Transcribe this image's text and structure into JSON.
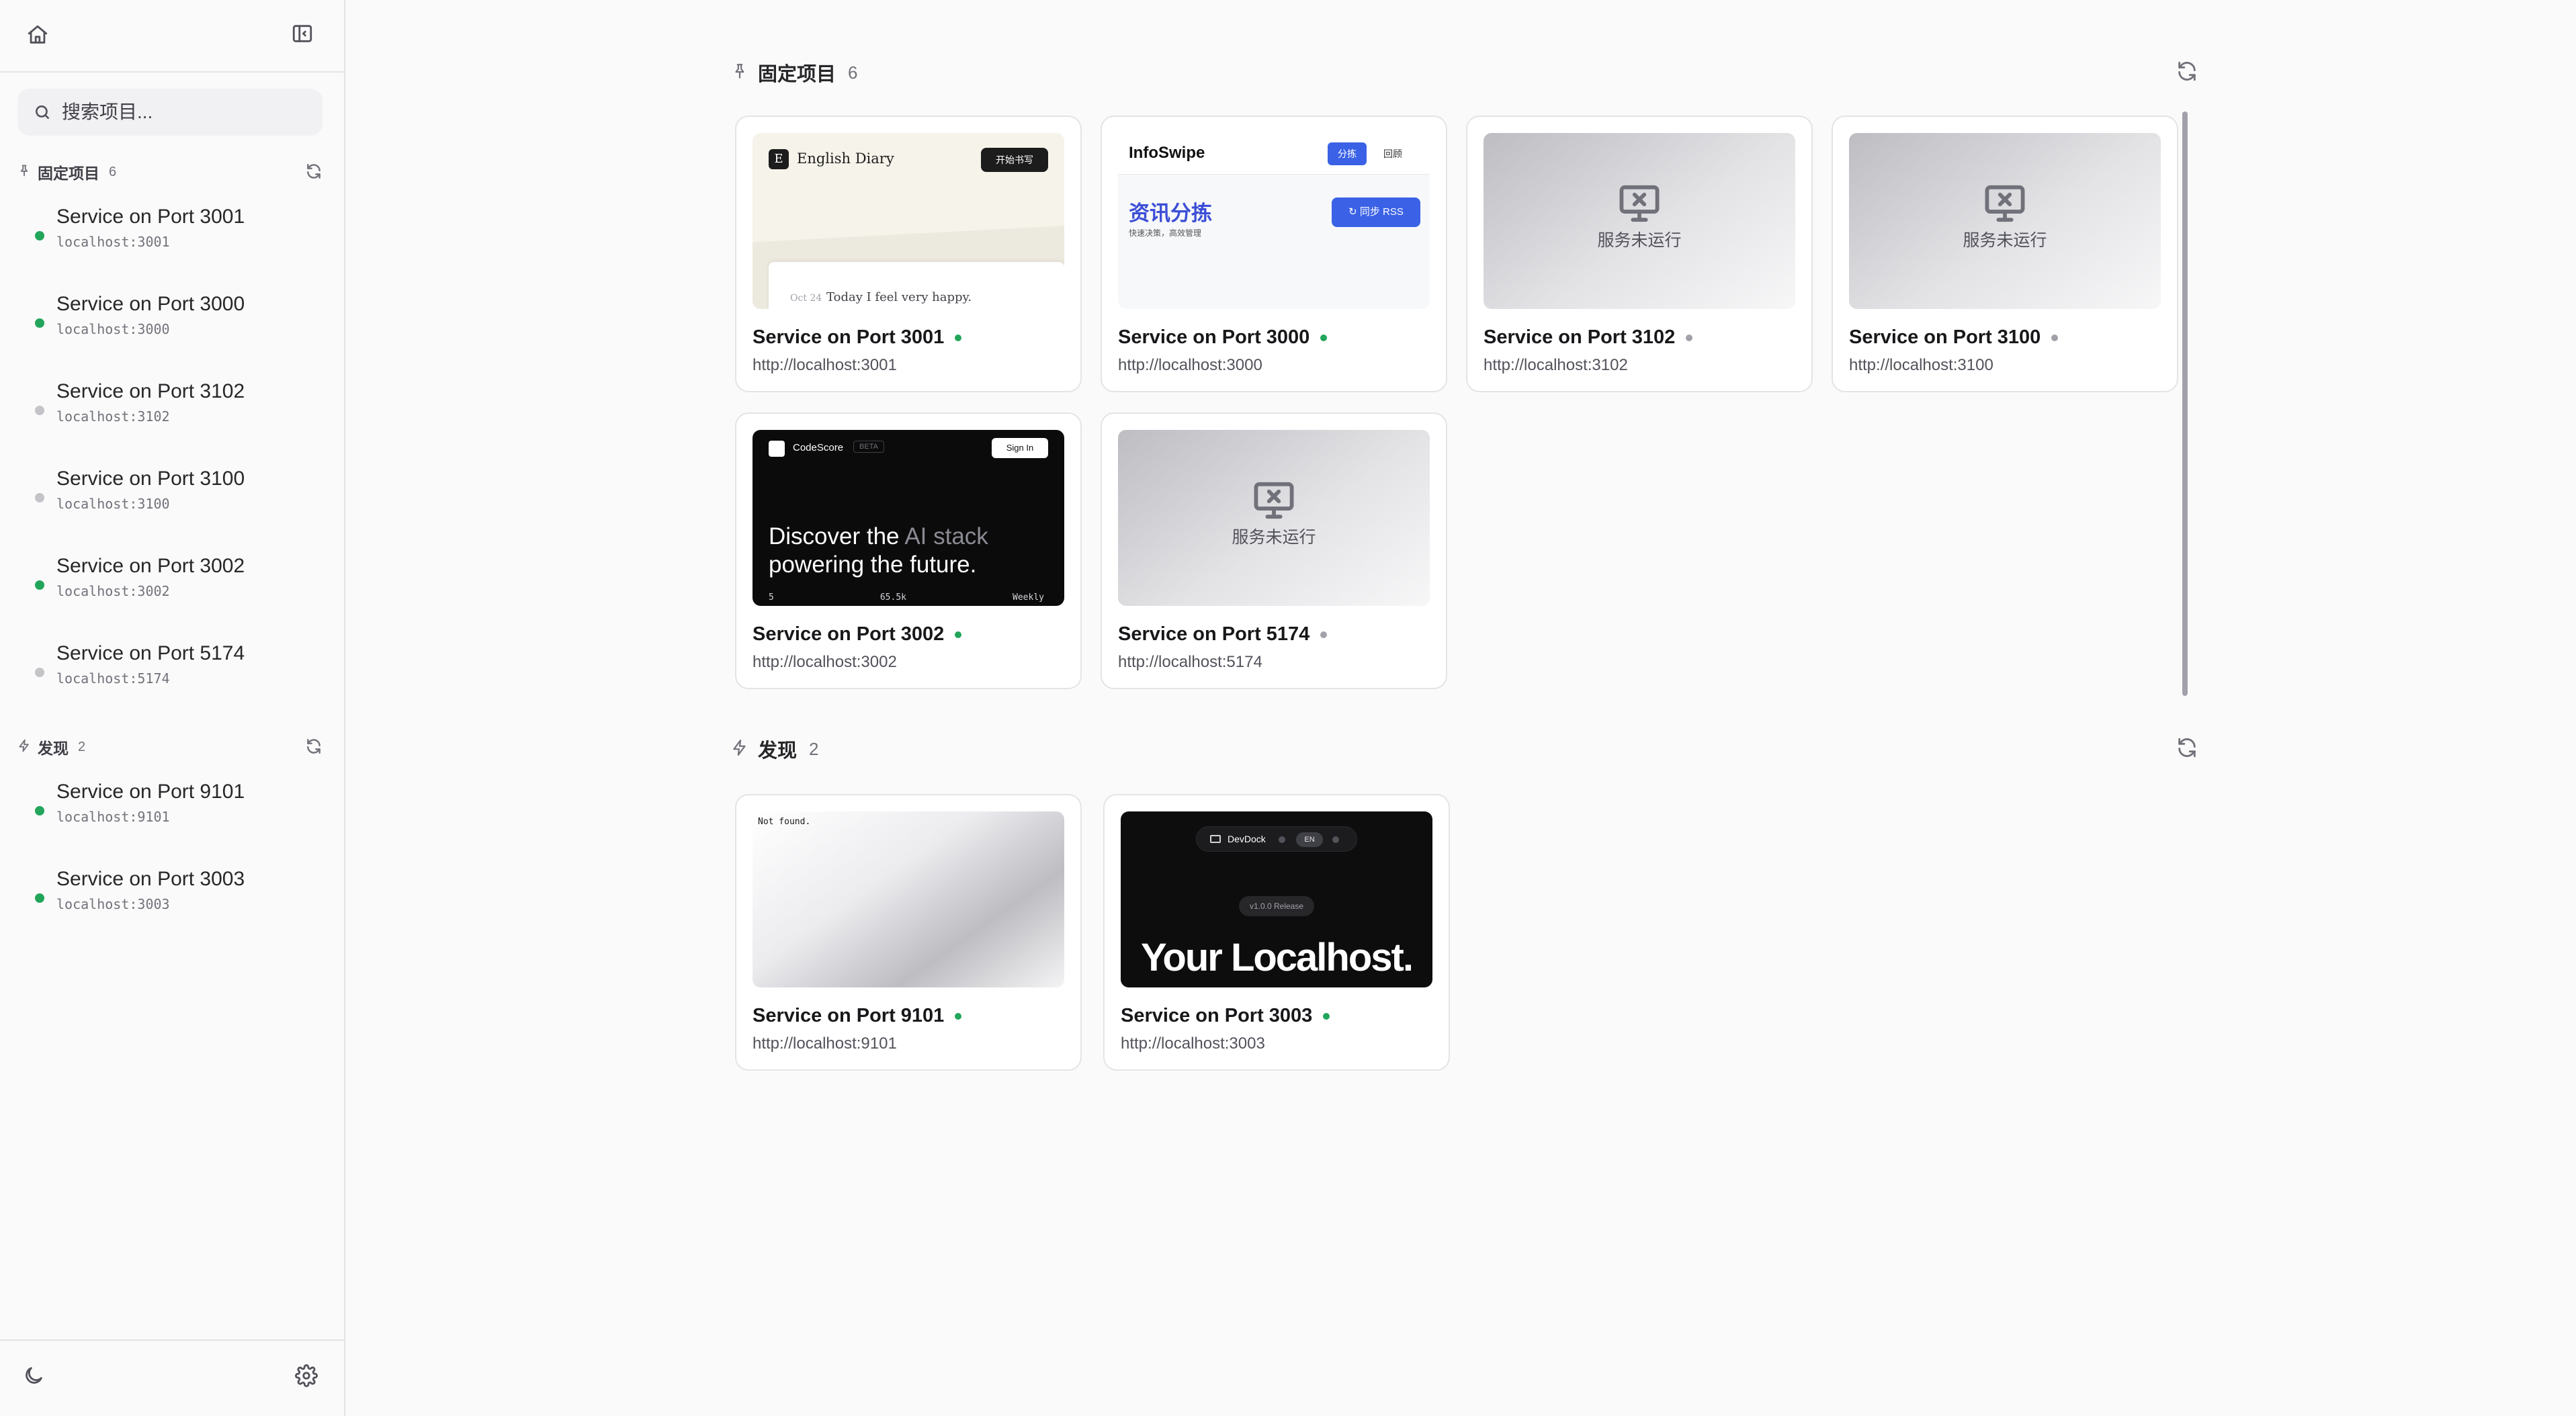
{
  "sidebar": {
    "search_placeholder": "搜索项目...",
    "pinned": {
      "title": "固定项目",
      "count": "6",
      "items": [
        {
          "name": "Service on Port 3001",
          "host": "localhost:3001",
          "status": "running"
        },
        {
          "name": "Service on Port 3000",
          "host": "localhost:3000",
          "status": "running"
        },
        {
          "name": "Service on Port 3102",
          "host": "localhost:3102",
          "status": "stopped"
        },
        {
          "name": "Service on Port 3100",
          "host": "localhost:3100",
          "status": "stopped"
        },
        {
          "name": "Service on Port 3002",
          "host": "localhost:3002",
          "status": "running"
        },
        {
          "name": "Service on Port 5174",
          "host": "localhost:5174",
          "status": "stopped"
        }
      ]
    },
    "discovered": {
      "title": "发现",
      "count": "2",
      "items": [
        {
          "name": "Service on Port 9101",
          "host": "localhost:9101",
          "status": "running"
        },
        {
          "name": "Service on Port 3003",
          "host": "localhost:3003",
          "status": "running"
        }
      ]
    },
    "icons": {
      "home": "home-icon",
      "collapse": "sidebar-collapse-icon",
      "theme": "moon-icon",
      "settings": "gear-icon"
    }
  },
  "main": {
    "pinned": {
      "title": "固定项目",
      "count": "6",
      "cards": [
        {
          "title": "Service on Port 3001",
          "url": "http://localhost:3001",
          "status": "running",
          "preview": "diary"
        },
        {
          "title": "Service on Port 3000",
          "url": "http://localhost:3000",
          "status": "running",
          "preview": "infoswipe"
        },
        {
          "title": "Service on Port 3102",
          "url": "http://localhost:3102",
          "status": "stopped",
          "preview": "offline"
        },
        {
          "title": "Service on Port 3100",
          "url": "http://localhost:3100",
          "status": "stopped",
          "preview": "offline"
        },
        {
          "title": "Service on Port 3002",
          "url": "http://localhost:3002",
          "status": "running",
          "preview": "codescore"
        },
        {
          "title": "Service on Port 5174",
          "url": "http://localhost:5174",
          "status": "stopped",
          "preview": "offline"
        }
      ]
    },
    "discovered": {
      "title": "发现",
      "count": "2",
      "cards": [
        {
          "title": "Service on Port 9101",
          "url": "http://localhost:9101",
          "status": "running",
          "preview": "notfound"
        },
        {
          "title": "Service on Port 3003",
          "url": "http://localhost:3003",
          "status": "running",
          "preview": "devdock"
        }
      ]
    },
    "offline_text": "服务未运行"
  },
  "previews": {
    "diary": {
      "brand": "English Diary",
      "logo_letter": "E",
      "button": "开始书写",
      "date": "Oct 24",
      "line": "Today I feel very happy."
    },
    "infoswipe": {
      "brand": "InfoSwipe",
      "tab_active": "分拣",
      "tab_other": "回顾",
      "headline": "资讯分拣",
      "subline": "快速决策，高效管理",
      "button": "同步 RSS"
    },
    "codescore": {
      "brand": "CodeScore",
      "badge": "BETA",
      "signin": "Sign In",
      "hero_a": "Discover the ",
      "hero_grey": "AI stack",
      "hero_b": "powering the future.",
      "stat1": "5",
      "stat2": "65.5k",
      "stat3": "Weekly"
    },
    "notfound": {
      "text": "Not found."
    },
    "devdock": {
      "brand": "DevDock",
      "lang": "EN",
      "release": "v1.0.0 Release",
      "headline": "Your Localhost."
    }
  },
  "colors": {
    "running": "#22a55b",
    "stopped": "#c4c4c8",
    "stopped_card_dot": "#a1a1aa",
    "accent": "#3b62e6"
  }
}
